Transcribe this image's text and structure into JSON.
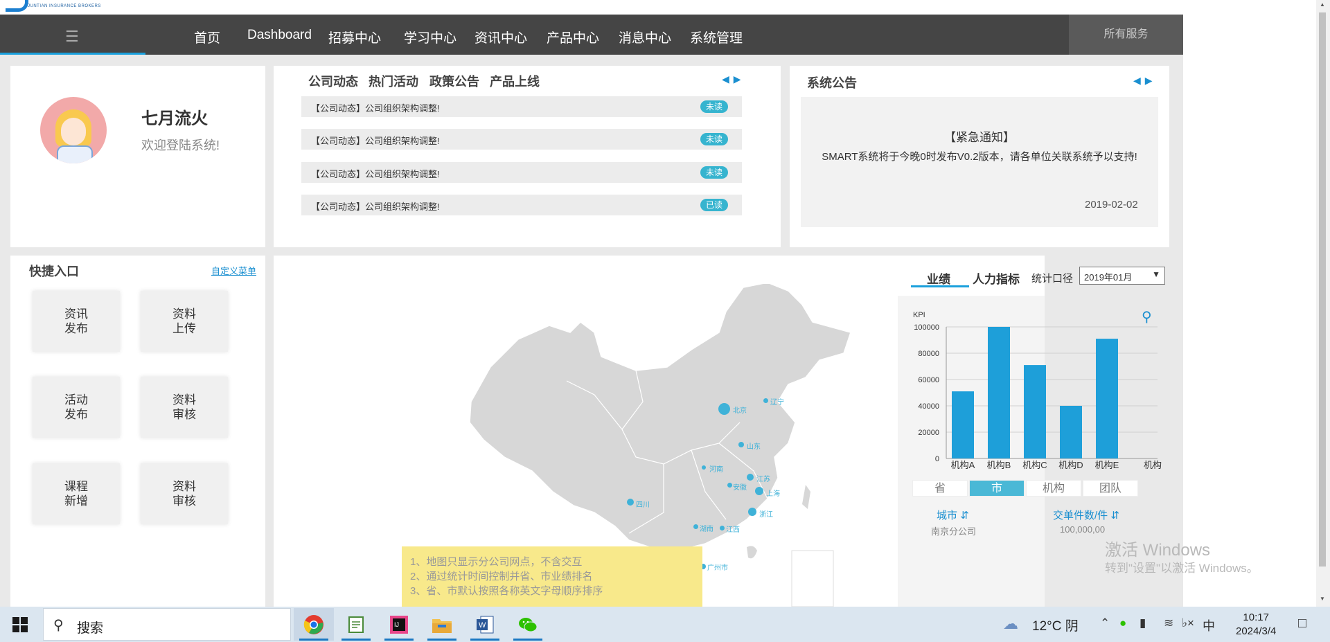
{
  "header": {
    "logo_tagline": "JUNTIAN INSURANCE BROKERS"
  },
  "nav": {
    "menu_icon": "hamburger-icon",
    "items": [
      "首页",
      "Dashboard",
      "招募中心",
      "学习中心",
      "资讯中心",
      "产品中心",
      "消息中心",
      "系统管理"
    ],
    "all_services": "所有服务"
  },
  "profile": {
    "name": "七月流火",
    "welcome": "欢迎登陆系统!"
  },
  "news": {
    "tabs": [
      "公司动态",
      "热门活动",
      "政策公告",
      "产品上线"
    ],
    "items": [
      {
        "text": "【公司动态】公司组织架构调整!",
        "badge": "未读"
      },
      {
        "text": "【公司动态】公司组织架构调整!",
        "badge": "未读"
      },
      {
        "text": "【公司动态】公司组织架构调整!",
        "badge": "未读"
      },
      {
        "text": "【公司动态】公司组织架构调整!",
        "badge": "已读"
      }
    ]
  },
  "notice": {
    "title": "系统公告",
    "head": "【紧急通知】",
    "body": "SMART系统将于今晚0时发布V0.2版本，请各单位关联系统予以支持!",
    "date": "2019-02-02"
  },
  "quick_entry": {
    "title": "快捷入口",
    "custom_link": "自定义菜单",
    "buttons": [
      [
        "资讯",
        "发布"
      ],
      [
        "资料",
        "上传"
      ],
      [
        "活动",
        "发布"
      ],
      [
        "资料",
        "审核"
      ],
      [
        "课程",
        "新增"
      ],
      [
        "资料",
        "审核"
      ]
    ]
  },
  "map": {
    "labels": [
      "北京",
      "辽宁",
      "山东",
      "河南",
      "江苏",
      "安徽",
      "上海",
      "浙江",
      "四川",
      "湖南",
      "江西",
      "广州市"
    ],
    "notes": [
      "1、地图只显示分公司网点，不含交互",
      "2、通过统计时间控制并省、市业绩排名",
      "3、省、市默认按照各称英文字母顺序排序"
    ]
  },
  "kpi": {
    "tabs": [
      "业绩",
      "人力指标"
    ],
    "period_label": "统计口径",
    "period_value": "2019年01月",
    "zoom_icon": "zoom-in-icon",
    "segments": [
      "省",
      "市",
      "机构",
      "团队"
    ],
    "active_segment": "市",
    "table": {
      "columns": [
        "城市",
        "交单件数/件"
      ],
      "rows": [
        [
          "南京分公司",
          "100,000,00"
        ]
      ]
    }
  },
  "chart_data": {
    "type": "bar",
    "ylabel": "KPI",
    "xlabel": "机构",
    "categories": [
      "机构A",
      "机构B",
      "机构C",
      "机构D",
      "机构E"
    ],
    "values": [
      51000,
      100000,
      71000,
      40000,
      91000
    ],
    "yticks": [
      0,
      20000,
      40000,
      60000,
      80000,
      100000
    ],
    "ylim": [
      0,
      100000
    ],
    "grid": true,
    "colors": {
      "bar": "#1e9fd9"
    }
  },
  "watermark": {
    "line1": "激活 Windows",
    "line2": "转到\"设置\"以激活 Windows。"
  },
  "taskbar": {
    "search_placeholder": "搜索",
    "apps": [
      "chrome-icon",
      "notepad-icon",
      "intellij-icon",
      "file-explorer-icon",
      "word-icon",
      "wechat-icon"
    ],
    "weather": "12°C  阴",
    "ime": "中",
    "time": "10:17",
    "date": "2024/3/4"
  }
}
